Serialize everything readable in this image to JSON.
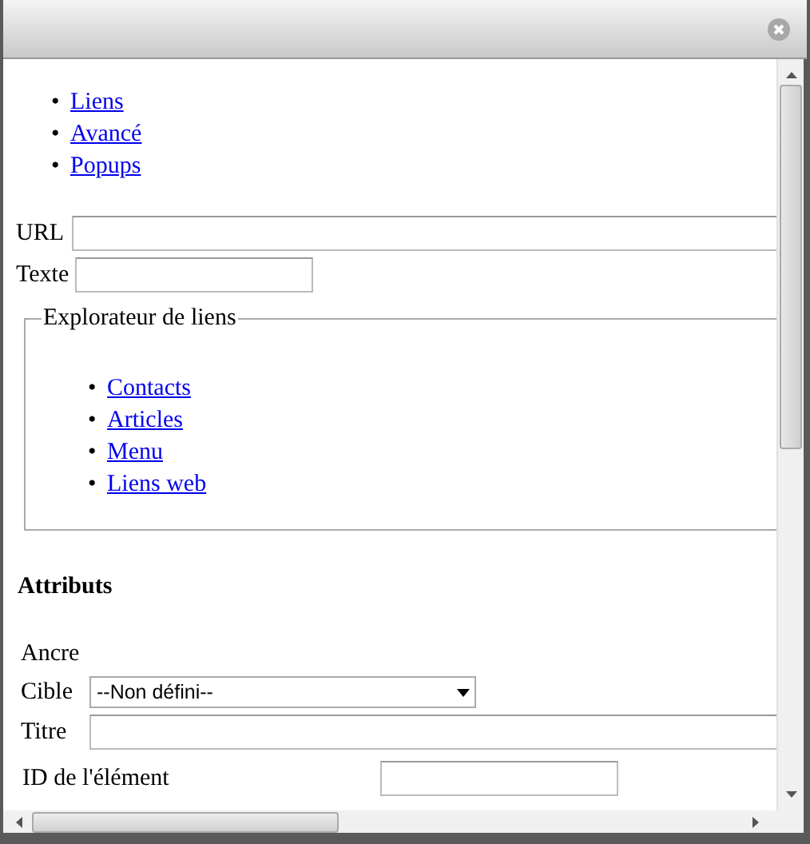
{
  "tabs": [
    {
      "marker": "•",
      "label": "Liens"
    },
    {
      "marker": "•",
      "label": "Avancé"
    },
    {
      "marker": "•",
      "label": "Popups"
    }
  ],
  "link": {
    "url_label": "URL",
    "text_label": "Texte"
  },
  "browser": {
    "legend": "Explorateur de liens",
    "items": [
      {
        "marker": "•",
        "label": "Contacts"
      },
      {
        "marker": "•",
        "label": "Articles"
      },
      {
        "marker": "•",
        "label": "Menu"
      },
      {
        "marker": "•",
        "label": "Liens web"
      }
    ]
  },
  "attributes": {
    "heading": "Attributs",
    "anchor_label": "Ancre",
    "target_label": "Cible",
    "target_value": "--Non défini--",
    "title_label": "Titre",
    "element_id_label": "ID de l'élément"
  }
}
